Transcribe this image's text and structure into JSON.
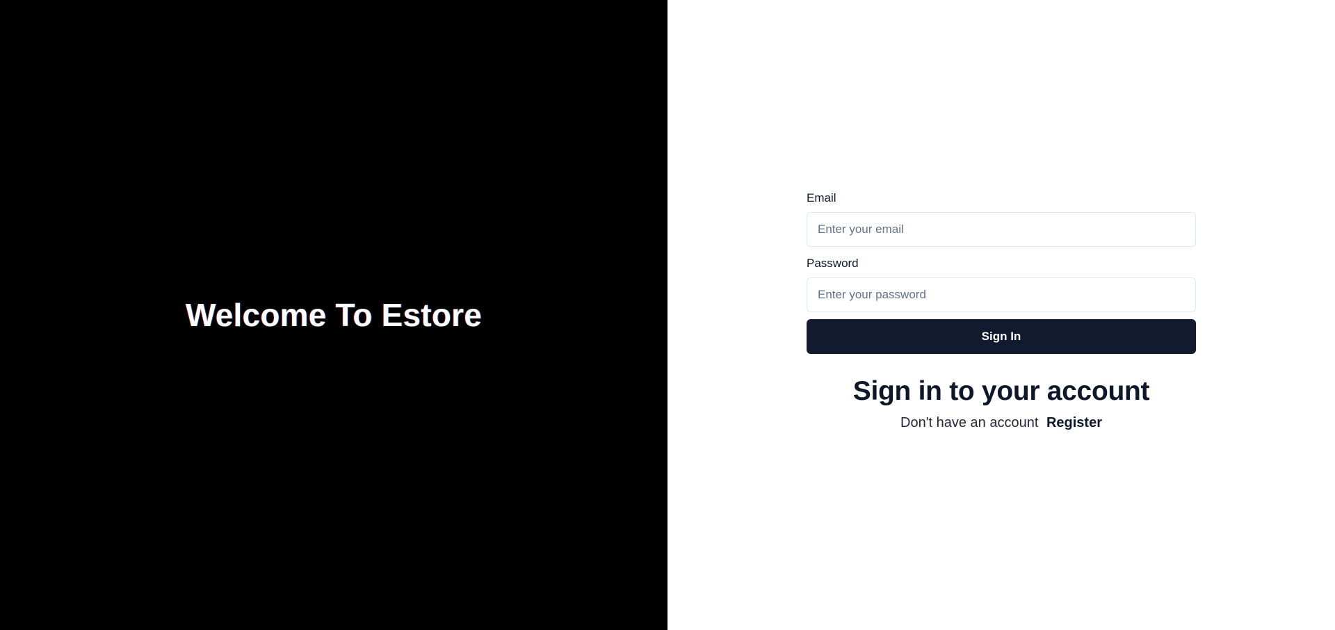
{
  "left_panel": {
    "welcome_text": "Welcome To Estore"
  },
  "login_form": {
    "email": {
      "label": "Email",
      "placeholder": "Enter your email",
      "value": ""
    },
    "password": {
      "label": "Password",
      "placeholder": "Enter your password",
      "value": ""
    },
    "submit_label": "Sign In",
    "heading": "Sign in to your account",
    "register_prompt": "Don't have an account",
    "register_link": "Register"
  },
  "colors": {
    "left_background": "#000000",
    "button_background": "#111a2e",
    "input_border": "#e2e8f0",
    "text_dark": "#0f172a"
  }
}
